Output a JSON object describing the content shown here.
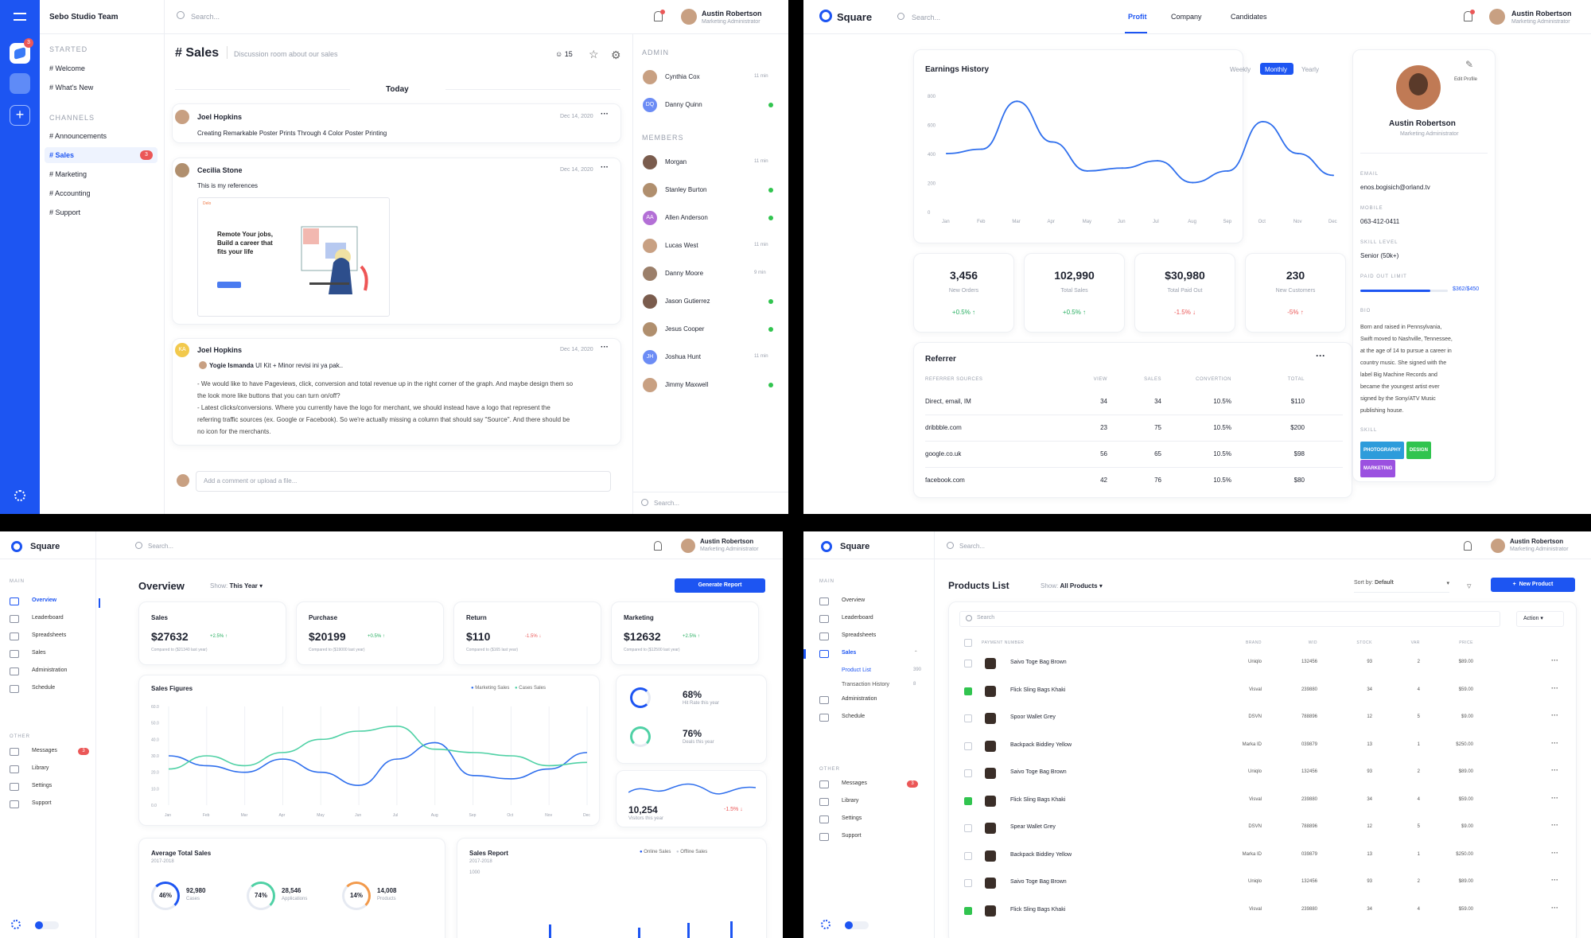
{
  "chat": {
    "team": "Sebo Studio Team",
    "search_placeholder": "Search...",
    "badge": "3",
    "started_label": "STARTED",
    "started": [
      "# Welcome",
      "# What's New"
    ],
    "channels_label": "CHANNELS",
    "channels": [
      "# Announcements",
      "# Sales",
      "# Marketing",
      "# Accounting",
      "# Support"
    ],
    "sales_badge": "3",
    "title": "# Sales",
    "subtitle": "Discussion room about our sales",
    "members_count": "15",
    "date_divider": "Today",
    "messages": [
      {
        "author": "Joel Hopkins",
        "date": "Dec 14, 2020",
        "text": "Creating Remarkable Poster Prints Through 4 Color Poster Printing"
      },
      {
        "author": "Cecilia Stone",
        "date": "Dec 14, 2020",
        "text": "This is my references"
      },
      {
        "author": "Joel Hopkins",
        "date": "Dec 14, 2020",
        "reply_author": "Yogie Ismanda",
        "reply_text": "UI Kit + Minor revisi ini ya pak..",
        "initials": "KA",
        "lines": [
          "- We would like to have Pageviews, click, conversion and total revenue up in the right corner of the graph. And maybe design them so",
          "the look more like buttons that you can turn on/off?",
          "- Latest clicks/conversions. Where you currently have the logo for merchant, we should instead have a logo that represent the",
          "referring traffic sources (ex. Google or Facebook). So we're actually missing a column that should say \"Source\". And there should be",
          "no icon for the merchants."
        ]
      }
    ],
    "ref_image_text": [
      "Remote Your jobs,",
      "Build a career that",
      "fits your life"
    ],
    "comment_placeholder": "Add a comment or upload a file...",
    "admin_label": "ADMIN",
    "admins": [
      {
        "name": "Cynthia Cox",
        "status": "11 min"
      },
      {
        "name": "Danny Quinn",
        "status": "online",
        "initials": "DQ"
      }
    ],
    "members_label": "MEMBERS",
    "members": [
      {
        "name": "Morgan",
        "status": "11 min"
      },
      {
        "name": "Stanley Burton",
        "status": "online"
      },
      {
        "name": "Allen Anderson",
        "status": "online",
        "initials": "AA"
      },
      {
        "name": "Lucas West",
        "status": "11 min"
      },
      {
        "name": "Danny Moore",
        "status": "9 min"
      },
      {
        "name": "Jason Gutierrez",
        "status": "online"
      },
      {
        "name": "Jesus Cooper",
        "status": "online"
      },
      {
        "name": "Joshua Hunt",
        "status": "11 min",
        "initials": "JH"
      },
      {
        "name": "Jimmy Maxwell",
        "status": "online"
      }
    ],
    "member_search": "Search..."
  },
  "user": {
    "name": "Austin Robertson",
    "role": "Marketing Administrator"
  },
  "brand": "Square",
  "profile": {
    "search": "Search...",
    "tabs": [
      "Profit",
      "Company",
      "Candidates"
    ],
    "active_tab": "Profit",
    "earnings_title": "Earnings History",
    "ranges": [
      "Weekly",
      "Monthly",
      "Yearly"
    ],
    "active_range": "Monthly",
    "stats": [
      {
        "value": "3,456",
        "label": "New Orders",
        "change": "+0.5% ↑",
        "dir": "up"
      },
      {
        "value": "102,990",
        "label": "Total Sales",
        "change": "+0.5% ↑",
        "dir": "up"
      },
      {
        "value": "$30,980",
        "label": "Total Paid Out",
        "change": "-1.5% ↓",
        "dir": "down"
      },
      {
        "value": "230",
        "label": "New Customers",
        "change": "-5% ↑",
        "dir": "down"
      }
    ],
    "referrer_title": "Referrer",
    "ref_headers": [
      "REFERRER SOURCES",
      "VIEW",
      "SALES",
      "CONVERTION",
      "TOTAL"
    ],
    "ref_rows": [
      [
        "Direct, email, IM",
        "34",
        "34",
        "10.5%",
        "$110"
      ],
      [
        "dribbble.com",
        "23",
        "75",
        "10.5%",
        "$200"
      ],
      [
        "google.co.uk",
        "56",
        "65",
        "10.5%",
        "$98"
      ],
      [
        "facebook.com",
        "42",
        "76",
        "10.5%",
        "$80"
      ]
    ],
    "edit_label": "Edit Profile",
    "name": "Austin Robertson",
    "role": "Marketing Administrator",
    "email_label": "EMAIL",
    "email": "enos.bogisich@orland.tv",
    "mobile_label": "MOBILE",
    "mobile": "063-412-0411",
    "skill_level_label": "SKILL LEVEL",
    "skill_level": "Senior (50k+)",
    "paid_label": "PAID OUT LIMIT",
    "paid_value": "$362/$450",
    "paid_fraction": 0.8,
    "bio_label": "BIO",
    "bio_lines": [
      "Born and raised in Pennsylvania,",
      "Swift moved to Nashville, Tennessee,",
      "at the age of 14 to pursue a career in",
      "country music. She signed with the",
      "label Big Machine Records and",
      "became the youngest artist ever",
      "signed by the Sony/ATV Music",
      "publishing house."
    ],
    "skill_label": "SKILL",
    "skills": [
      {
        "name": "PHOTOGRAPHY",
        "color": "#2d9cdb"
      },
      {
        "name": "DESIGN",
        "color": "#31c44f"
      },
      {
        "name": "MARKETING",
        "color": "#9b51e0"
      }
    ]
  },
  "earnings_chart": {
    "type": "line",
    "categories": [
      "Jan",
      "Feb",
      "Mar",
      "Apr",
      "May",
      "Jun",
      "Jul",
      "Aug",
      "Sep",
      "Oct",
      "Nov",
      "Dec"
    ],
    "y_ticks": [
      "0",
      "200",
      "400",
      "600",
      "800"
    ],
    "ylim": [
      0,
      800
    ],
    "values": [
      400,
      430,
      760,
      480,
      280,
      300,
      350,
      200,
      280,
      620,
      400,
      250
    ],
    "color": "#2f6fed"
  },
  "overview": {
    "search": "Search...",
    "main_label": "MAIN",
    "other_label": "OTHER",
    "nav": [
      "Overview",
      "Leaderboard",
      "Spreadsheets",
      "Sales",
      "Administration",
      "Schedule"
    ],
    "other": [
      "Messages",
      "Library",
      "Settings",
      "Support"
    ],
    "messages_badge": "3",
    "title": "Overview",
    "show_label": "Show:",
    "show_value": "This Year",
    "report_btn": "Generate Report",
    "kpis": [
      {
        "label": "Sales",
        "value": "$27632",
        "change": "+2.5% ↑",
        "dir": "up",
        "compare": "Compared to ($21340 last year)"
      },
      {
        "label": "Purchase",
        "value": "$20199",
        "change": "+0.5% ↑",
        "dir": "up",
        "compare": "Compared to ($19000 last year)"
      },
      {
        "label": "Return",
        "value": "$110",
        "change": "-1.5% ↓",
        "dir": "down",
        "compare": "Compared to ($165 last year)"
      },
      {
        "label": "Marketing",
        "value": "$12632",
        "change": "+2.5% ↑",
        "dir": "up",
        "compare": "Compared to ($12500 last year)"
      }
    ],
    "figures_title": "Sales Figures",
    "legend": [
      "Marketing Sales",
      "Cases Sales"
    ],
    "hit_rate": {
      "value": "68%",
      "label": "Hit Rate this year"
    },
    "deals": {
      "value": "76%",
      "label": "Deals this year"
    },
    "visitors": {
      "value": "10,254",
      "label": "Visitors this year",
      "change": "-1.5% ↓"
    },
    "avg_title": "Average Total Sales",
    "avg_years": "2017-2018",
    "avg_items": [
      {
        "pct": "46%",
        "num": "92,980",
        "lbl": "Cases"
      },
      {
        "pct": "74%",
        "num": "28,546",
        "lbl": "Applications"
      },
      {
        "pct": "14%",
        "num": "14,008",
        "lbl": "Products"
      }
    ],
    "report_title": "Sales Report",
    "report_years": "2017-2018",
    "report_legend": [
      "Online Sales",
      "Offline Sales"
    ],
    "report_tick": "1000"
  },
  "figures_chart": {
    "type": "line",
    "categories": [
      "Jan",
      "Feb",
      "Mar",
      "Apr",
      "May",
      "Jun",
      "Jul",
      "Aug",
      "Sep",
      "Oct",
      "Nov",
      "Dec"
    ],
    "y_ticks": [
      "0.0",
      "10.0",
      "20.0",
      "30.0",
      "40.0",
      "50.0",
      "60.0"
    ],
    "ylim": [
      0,
      60
    ],
    "series": [
      {
        "name": "Marketing Sales",
        "color": "#2f6fed",
        "values": [
          30,
          24,
          20,
          28,
          20,
          12,
          28,
          38,
          18,
          16,
          22,
          32
        ]
      },
      {
        "name": "Cases Sales",
        "color": "#4fd1a5",
        "values": [
          22,
          30,
          24,
          32,
          40,
          45,
          48,
          34,
          32,
          30,
          24,
          26
        ]
      }
    ]
  },
  "products": {
    "search": "Search...",
    "title": "Products List",
    "show_label": "Show:",
    "show_value": "All Products",
    "sort_label": "Sort by:",
    "sort_value": "Default",
    "new_btn": "New Product",
    "table_search": "Search",
    "action_label": "Action",
    "sub_nav": [
      "Product List",
      "Transaction History"
    ],
    "sub_counts": [
      "390",
      "8"
    ],
    "headers": [
      "PAYMENT NUMBER",
      "BRAND",
      "WID",
      "STOCK",
      "VAR",
      "PRICE"
    ],
    "rows": [
      {
        "name": "Saivo Toge Bag Brown",
        "brand": "Uniqlo",
        "wid": "132456",
        "stock": "93",
        "var": "2",
        "price": "$89.00",
        "checked": false
      },
      {
        "name": "Flick Sling Bags Khaki",
        "brand": "Visval",
        "wid": "239880",
        "stock": "34",
        "var": "4",
        "price": "$59.00",
        "checked": true
      },
      {
        "name": "Spoor Wallet Grey",
        "brand": "DSVN",
        "wid": "788896",
        "stock": "12",
        "var": "5",
        "price": "$9.00",
        "checked": false
      },
      {
        "name": "Backpack Biddley Yellow",
        "brand": "Marka ID",
        "wid": "039879",
        "stock": "13",
        "var": "1",
        "price": "$250.00",
        "checked": false
      },
      {
        "name": "Saivo Toge Bag Brown",
        "brand": "Uniqlo",
        "wid": "132456",
        "stock": "93",
        "var": "2",
        "price": "$89.00",
        "checked": false
      },
      {
        "name": "Flick Sling Bags Khaki",
        "brand": "Visval",
        "wid": "239880",
        "stock": "34",
        "var": "4",
        "price": "$59.00",
        "checked": true
      },
      {
        "name": "Spear Wallet Grey",
        "brand": "DSVN",
        "wid": "788896",
        "stock": "12",
        "var": "5",
        "price": "$9.00",
        "checked": false
      },
      {
        "name": "Backpack Biddley Yellow",
        "brand": "Marka ID",
        "wid": "039879",
        "stock": "13",
        "var": "1",
        "price": "$250.00",
        "checked": false
      },
      {
        "name": "Saivo Toge Bag Brown",
        "brand": "Uniqlo",
        "wid": "132456",
        "stock": "93",
        "var": "2",
        "price": "$89.00",
        "checked": false
      },
      {
        "name": "Flick Sling Bags Khaki",
        "brand": "Visval",
        "wid": "239880",
        "stock": "34",
        "var": "4",
        "price": "$59.00",
        "checked": true
      }
    ]
  }
}
